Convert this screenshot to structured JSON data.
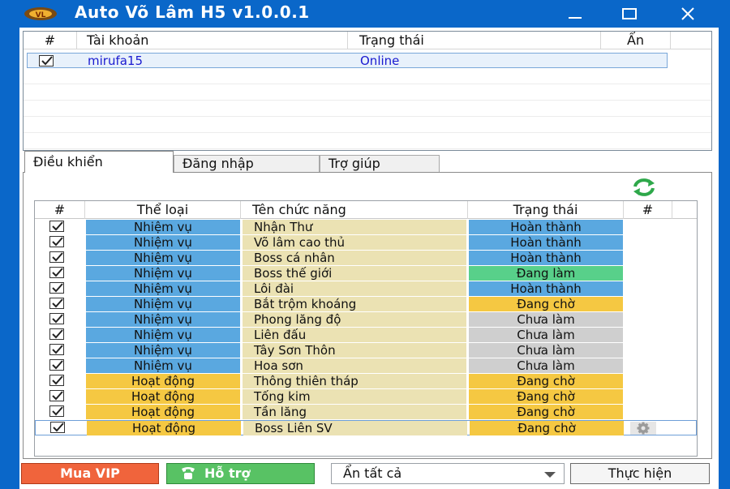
{
  "window": {
    "title": "Auto Võ Lâm H5 v1.0.0.1",
    "icons": {
      "app": "app-logo-icon",
      "minimize": "minimize-icon",
      "maximize": "maximize-icon",
      "close": "close-icon"
    }
  },
  "accounts": {
    "columns": [
      "#",
      "Tài khoản",
      "Trạng thái",
      "Ẩn"
    ],
    "rows": [
      {
        "checked": true,
        "account": "mirufa15",
        "status": "Online",
        "hidden": ""
      }
    ]
  },
  "tabs": [
    {
      "label": "Điều khiển",
      "active": true
    },
    {
      "label": "Đăng nhập",
      "active": false
    },
    {
      "label": "Trợ giúp",
      "active": false
    }
  ],
  "tasks": {
    "columns": [
      "#",
      "Thể loại",
      "Tên chức năng",
      "Trạng thái",
      "#"
    ],
    "rows": [
      {
        "checked": true,
        "category": "Nhiệm vụ",
        "cat": "nv",
        "name": "Nhận Thư",
        "status": "Hoàn thành",
        "st": "done"
      },
      {
        "checked": true,
        "category": "Nhiệm vụ",
        "cat": "nv",
        "name": "Võ lâm cao thủ",
        "status": "Hoàn thành",
        "st": "done"
      },
      {
        "checked": true,
        "category": "Nhiệm vụ",
        "cat": "nv",
        "name": "Boss cá nhân",
        "status": "Hoàn thành",
        "st": "done"
      },
      {
        "checked": true,
        "category": "Nhiệm vụ",
        "cat": "nv",
        "name": "Boss thế giới",
        "status": "Đang làm",
        "st": "doing"
      },
      {
        "checked": true,
        "category": "Nhiệm vụ",
        "cat": "nv",
        "name": "Lôi đài",
        "status": "Hoàn thành",
        "st": "done"
      },
      {
        "checked": true,
        "category": "Nhiệm vụ",
        "cat": "nv",
        "name": "Bắt trộm khoáng",
        "status": "Đang chờ",
        "st": "wait"
      },
      {
        "checked": true,
        "category": "Nhiệm vụ",
        "cat": "nv",
        "name": "Phong lăng độ",
        "status": "Chưa làm",
        "st": "none"
      },
      {
        "checked": true,
        "category": "Nhiệm vụ",
        "cat": "nv",
        "name": "Liên đấu",
        "status": "Chưa làm",
        "st": "none"
      },
      {
        "checked": true,
        "category": "Nhiệm vụ",
        "cat": "nv",
        "name": "Tây Sơn Thôn",
        "status": "Chưa làm",
        "st": "none"
      },
      {
        "checked": true,
        "category": "Nhiệm vụ",
        "cat": "nv",
        "name": "Hoa sơn",
        "status": "Chưa làm",
        "st": "none"
      },
      {
        "checked": true,
        "category": "Hoạt động",
        "cat": "hd",
        "name": "Thông thiên tháp",
        "status": "Đang chờ",
        "st": "wait"
      },
      {
        "checked": true,
        "category": "Hoạt động",
        "cat": "hd",
        "name": "Tống kim",
        "status": "Đang chờ",
        "st": "wait"
      },
      {
        "checked": true,
        "category": "Hoạt động",
        "cat": "hd",
        "name": "Tần lăng",
        "status": "Đang chờ",
        "st": "wait"
      },
      {
        "checked": true,
        "category": "Hoạt động",
        "cat": "hd",
        "name": "Boss Liên SV",
        "status": "Đang chờ",
        "st": "wait",
        "settings": "gear-icon"
      }
    ]
  },
  "colors": {
    "titlebar": "#0a67c9",
    "category_nhiem_vu": "#5aa8e0",
    "category_hoat_dong": "#f5c842",
    "name_cell": "#ebe2b3",
    "status_done": "#5aa8e0",
    "status_doing": "#58d08a",
    "status_wait": "#f5c842",
    "status_none": "#cfcfcf",
    "vip_button": "#f0643c",
    "support_button": "#58c264"
  },
  "bottom": {
    "vip_label": "Mua VIP",
    "support_label": "Hỗ trợ",
    "select_value": "Ẩn tất cả",
    "run_label": "Thực hiện"
  }
}
